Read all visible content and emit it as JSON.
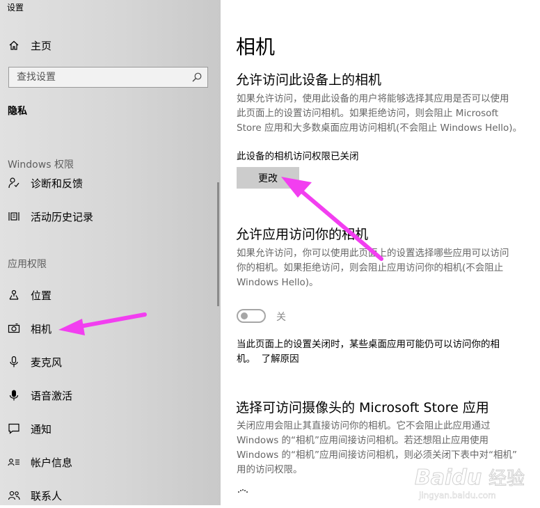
{
  "window": {
    "title": "设置"
  },
  "sidebar": {
    "home_label": "主页",
    "search": {
      "placeholder": "查找设置"
    },
    "section_title": "隐私",
    "windows_group_label": "Windows 权限",
    "windows_items": [
      {
        "label": "诊断和反馈",
        "icon": "diagnostics-icon"
      },
      {
        "label": "活动历史记录",
        "icon": "activity-history-icon"
      }
    ],
    "app_group_label": "应用权限",
    "app_items": [
      {
        "label": "位置",
        "icon": "location-icon"
      },
      {
        "label": "相机",
        "icon": "camera-icon",
        "selected": true
      },
      {
        "label": "麦克风",
        "icon": "microphone-icon"
      },
      {
        "label": "语音激活",
        "icon": "voice-activation-icon"
      },
      {
        "label": "通知",
        "icon": "notification-icon"
      },
      {
        "label": "帐户信息",
        "icon": "account-info-icon"
      },
      {
        "label": "联系人",
        "icon": "contacts-icon"
      }
    ]
  },
  "main": {
    "title": "相机",
    "device_section": {
      "heading": "允许访问此设备上的相机",
      "desc_lines": [
        "如果允许访问，使用此设备的用户将能够选择其应用是否可以使用",
        "此页面上的设置访问相机。如果拒绝访问，则会阻止 Microsoft",
        "Store 应用和大多数桌面应用访问相机(不会阻止 Windows Hello)。"
      ],
      "status": "此设备的相机访问权限已关闭",
      "button_label": "更改"
    },
    "app_section": {
      "heading": "允许应用访问你的相机",
      "desc_lines": [
        "如果允许访问，你可以使用此页面上的设置选择哪些应用可以访问",
        "你的相机。如果拒绝访问，则会阻止应用访问你的相机(不会阻止",
        "Windows Hello)。"
      ],
      "toggle_state": "关",
      "toggle_on": false,
      "note_lines": [
        "当此页面上的设置关闭时，某些桌面应用可能仍可以访问你的相",
        "机。"
      ],
      "learn_more": "了解原因"
    },
    "store_section": {
      "heading": "选择可访问摄像头的 Microsoft Store 应用",
      "desc_lines": [
        "关闭应用会阻止其直接访问你的相机。它不会阻止此应用通过",
        "Windows 的“相机”应用间接访问相机。若还想阻止应用使用",
        "Windows 的“相机”应用间接访问相机，则必须关闭下表中对“相机”",
        "用的访问权限。"
      ]
    }
  },
  "watermark": {
    "brand": "Baidu",
    "brand_cn": "经验",
    "url": "jingyan.baidu.com"
  },
  "colors": {
    "annotation_arrow": "#f23ef0",
    "sidebar_bg": "#d6d6d6",
    "button_bg": "#cccccc"
  }
}
